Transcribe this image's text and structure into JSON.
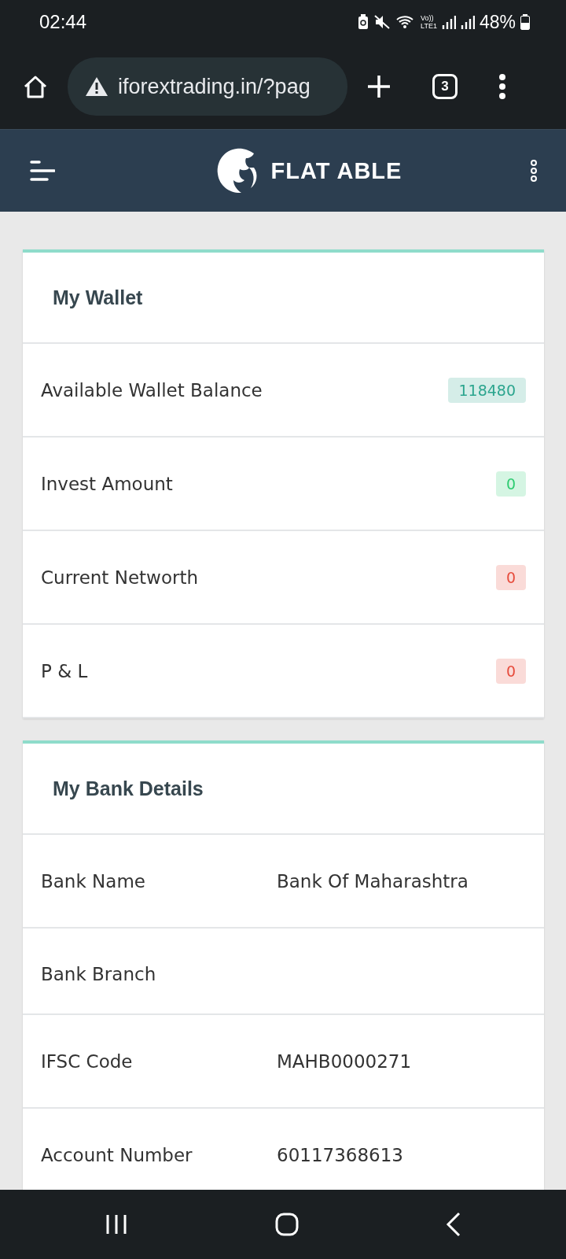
{
  "status_bar": {
    "time": "02:44",
    "network_top": "Vo))",
    "network_bottom": "LTE1",
    "battery": "48%"
  },
  "browser": {
    "url": "iforextrading.in/?pag",
    "tab_count": "3"
  },
  "header": {
    "brand": "FLAT ABLE"
  },
  "wallet": {
    "title": "My Wallet",
    "rows": [
      {
        "label": "Available Wallet Balance",
        "value": "118480",
        "color": "#2ba58e"
      },
      {
        "label": "Invest Amount",
        "value": "0",
        "color": "#2ecc71"
      },
      {
        "label": "Current Networth",
        "value": "0",
        "color": "#e74c3c"
      },
      {
        "label": "P & L",
        "value": "0",
        "color": "#e74c3c"
      }
    ]
  },
  "bank": {
    "title": "My Bank Details",
    "rows": [
      {
        "label": "Bank Name",
        "value": "Bank Of Maharashtra"
      },
      {
        "label": "Bank Branch"
      },
      {
        "label": "IFSC Code",
        "value": "MAHB0000271"
      },
      {
        "label": "Account Number",
        "value": "60117368613"
      }
    ]
  }
}
